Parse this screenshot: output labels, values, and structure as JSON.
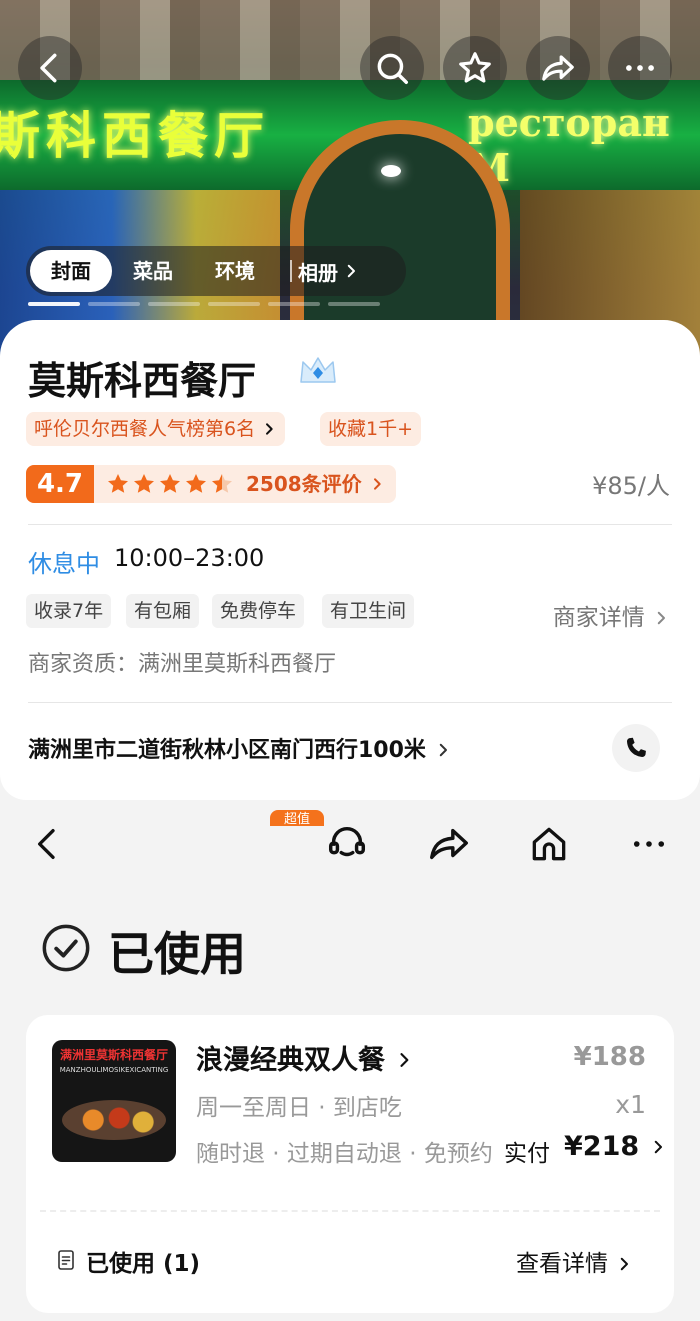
{
  "hero": {
    "sign_left": "斯科西餐厅",
    "sign_right": "ресторан М",
    "tabs": [
      {
        "label": "封面",
        "active": true
      },
      {
        "label": "菜品",
        "active": false
      },
      {
        "label": "环境",
        "active": false
      }
    ],
    "album_label": "相册",
    "icons": [
      "back-icon",
      "search-icon",
      "star-icon",
      "share-icon",
      "more-icon"
    ]
  },
  "shop": {
    "name": "莫斯科西餐厅",
    "rank_badge": "呼伦贝尔西餐人气榜第6名",
    "favorites_badge": "收藏1千+",
    "rating": "4.7",
    "stars": 4.5,
    "review_count": "2508条评价",
    "avg_price": "¥85/人",
    "status": "休息中",
    "hours": "10:00–23:00",
    "tags": [
      "收录7年",
      "有包厢",
      "免费停车",
      "有卫生间"
    ],
    "merchant_detail": "商家详情",
    "qualification": "商家资质：满洲里莫斯科西餐厅",
    "address": "满洲里市二道街秋林小区南门西行100米"
  },
  "order_page": {
    "super_badge": "超值",
    "status_title": "已使用",
    "product": {
      "thumb_title": "满洲里莫斯科西餐厅",
      "thumb_subtitle": "MANZHOULIMOSIKEXICANTING",
      "name": "浪漫经典双人餐",
      "subtitle1": "周一至周日 · 到店吃",
      "subtitle2": "随时退 · 过期自动退 · 免预约",
      "price": "¥188",
      "quantity": "x1",
      "paid_label": "实付",
      "paid_amount": "¥218"
    },
    "footer_status": "已使用 (1)",
    "view_detail": "查看详情"
  },
  "colors": {
    "accent_orange": "#f26a1b",
    "badge_bg": "#fdece2",
    "status_blue": "#2f8de4",
    "sign_green": "#18b043"
  }
}
